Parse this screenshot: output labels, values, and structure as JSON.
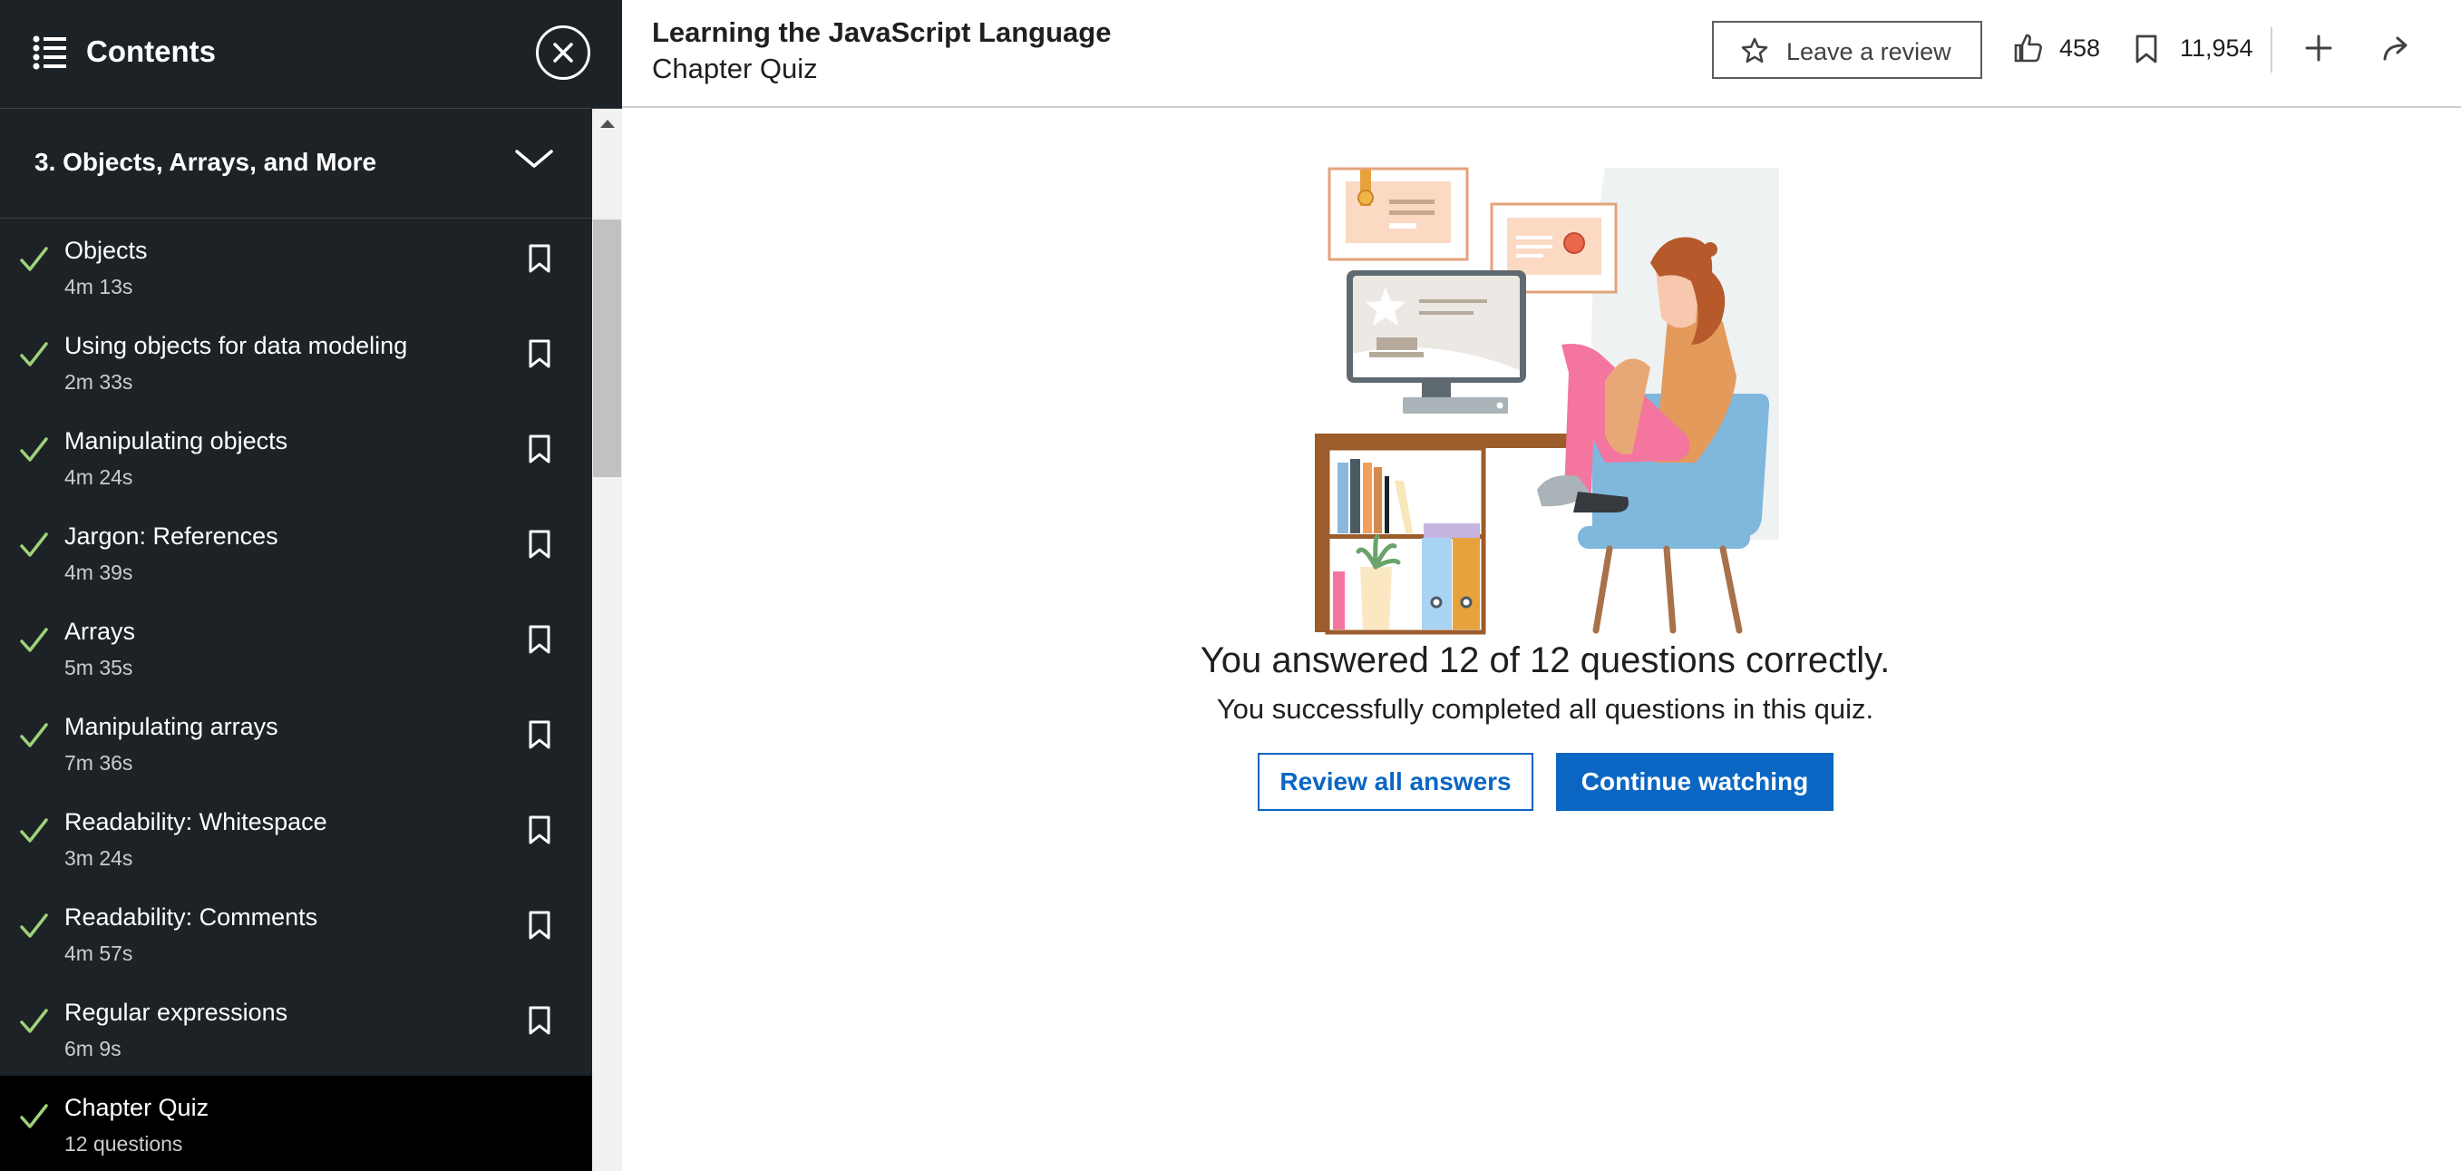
{
  "sidebar": {
    "title": "Contents",
    "section": "3. Objects, Arrays, and More",
    "items": [
      {
        "title": "Objects",
        "sub": "4m 13s"
      },
      {
        "title": "Using objects for data modeling",
        "sub": "2m 33s"
      },
      {
        "title": "Manipulating objects",
        "sub": "4m 24s"
      },
      {
        "title": "Jargon: References",
        "sub": "4m 39s"
      },
      {
        "title": "Arrays",
        "sub": "5m 35s"
      },
      {
        "title": "Manipulating arrays",
        "sub": "7m 36s"
      },
      {
        "title": "Readability: Whitespace",
        "sub": "3m 24s"
      },
      {
        "title": "Readability: Comments",
        "sub": "4m 57s"
      },
      {
        "title": "Regular expressions",
        "sub": "6m 9s"
      },
      {
        "title": "Chapter Quiz",
        "sub": "12 questions"
      }
    ]
  },
  "header": {
    "course_title": "Learning the JavaScript Language",
    "page_subtitle": "Chapter Quiz",
    "review_label": "Leave a review",
    "likes": "458",
    "saves": "11,954"
  },
  "quiz": {
    "result": "You answered 12 of 12 questions correctly.",
    "message": "You successfully completed all questions in this quiz.",
    "review_button": "Review all answers",
    "continue_button": "Continue watching"
  },
  "colors": {
    "accent": "#0a66c2",
    "sidebar_bg": "#1d2226",
    "check_green": "#9fd27a"
  }
}
